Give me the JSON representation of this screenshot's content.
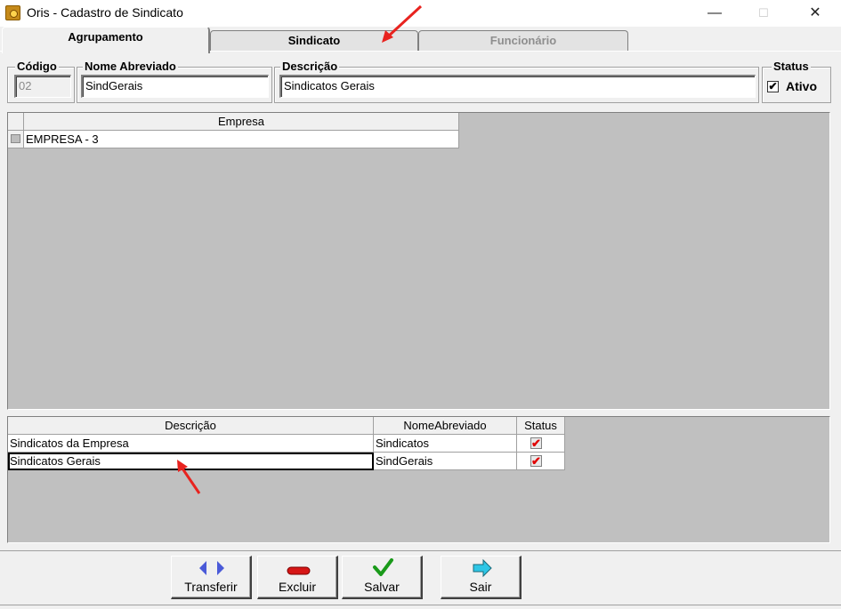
{
  "window": {
    "title": "Oris - Cadastro de Sindicato",
    "minimize": "—",
    "maximize": "☐",
    "close": "✕"
  },
  "tabs": [
    {
      "label": "Agrupamento",
      "state": "active"
    },
    {
      "label": "Sindicato",
      "state": "normal"
    },
    {
      "label": "Funcionário",
      "state": "disabled"
    }
  ],
  "form": {
    "codigo_label": "Código",
    "codigo_value": "02",
    "nome_label": "Nome Abreviado",
    "nome_value": "SindGerais",
    "descricao_label": "Descrição",
    "descricao_value": "Sindicatos Gerais",
    "status_label": "Status",
    "ativo_label": "Ativo",
    "ativo_checked": "✔"
  },
  "empresa_grid": {
    "header": "Empresa",
    "rows": [
      "EMPRESA - 3"
    ]
  },
  "sindicato_grid": {
    "headers": [
      "Descrição",
      "NomeAbreviado",
      "Status"
    ],
    "rows": [
      {
        "descricao": "Sindicatos da Empresa",
        "nome": "Sindicatos",
        "status": "✔"
      },
      {
        "descricao": "Sindicatos Gerais",
        "nome": "SindGerais",
        "status": "✔"
      }
    ]
  },
  "buttons": {
    "transferir": "Transferir",
    "excluir": "Excluir",
    "salvar": "Salvar",
    "sair": "Sair"
  },
  "colors": {
    "annotation_arrow": "#e8231f",
    "grid_bg": "#c0c0c0",
    "window_bg": "#f0f0f0"
  }
}
